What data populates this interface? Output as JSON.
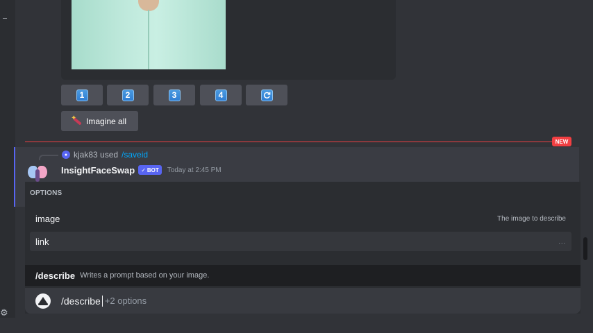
{
  "embed": {
    "image_alt": ""
  },
  "action_buttons": {
    "upscale": [
      "1",
      "2",
      "3",
      "4"
    ],
    "reroll_icon": "refresh-icon",
    "imagine_all_label": "Imagine all",
    "imagine_all_icon": "magic-wand-icon"
  },
  "divider": {
    "badge": "NEW"
  },
  "message": {
    "reply_user": "kjak83 used",
    "reply_command": "/saveid",
    "author": "InsightFaceSwap",
    "bot_tag": "BOT",
    "timestamp": "Today at 2:45 PM"
  },
  "command_panel": {
    "options_header": "OPTIONS",
    "options": [
      {
        "name": "image",
        "description": "The image to describe"
      },
      {
        "name": "link",
        "description": "..."
      }
    ],
    "suggestion": {
      "command": "/describe",
      "description": "Writes a prompt based on your image."
    }
  },
  "input": {
    "command": "/describe",
    "extra": "+2 options"
  },
  "colors": {
    "background": "#313338",
    "accent": "#5865f2",
    "new_divider": "#f23f42",
    "link": "#00a8fc"
  }
}
